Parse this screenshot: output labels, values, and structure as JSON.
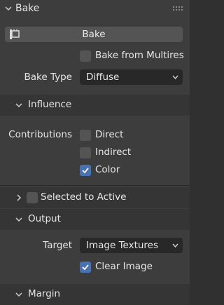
{
  "panel": {
    "title": "Bake"
  },
  "bake_button": {
    "label": "Bake"
  },
  "bake_from_multires": {
    "label": "Bake from Multires",
    "checked": false
  },
  "bake_type": {
    "label": "Bake Type",
    "value": "Diffuse"
  },
  "influence": {
    "title": "Influence",
    "contributions_label": "Contributions",
    "options": [
      {
        "label": "Direct",
        "checked": false
      },
      {
        "label": "Indirect",
        "checked": false
      },
      {
        "label": "Color",
        "checked": true
      }
    ]
  },
  "selected_to_active": {
    "label": "Selected to Active",
    "checked": false
  },
  "output": {
    "title": "Output",
    "target_label": "Target",
    "target_value": "Image Textures",
    "clear_image": {
      "label": "Clear Image",
      "checked": true
    }
  },
  "margin": {
    "title": "Margin"
  },
  "colors": {
    "accent": "#4772b3",
    "panel": "#3d3d3d",
    "field": "#282828",
    "button": "#545454"
  }
}
